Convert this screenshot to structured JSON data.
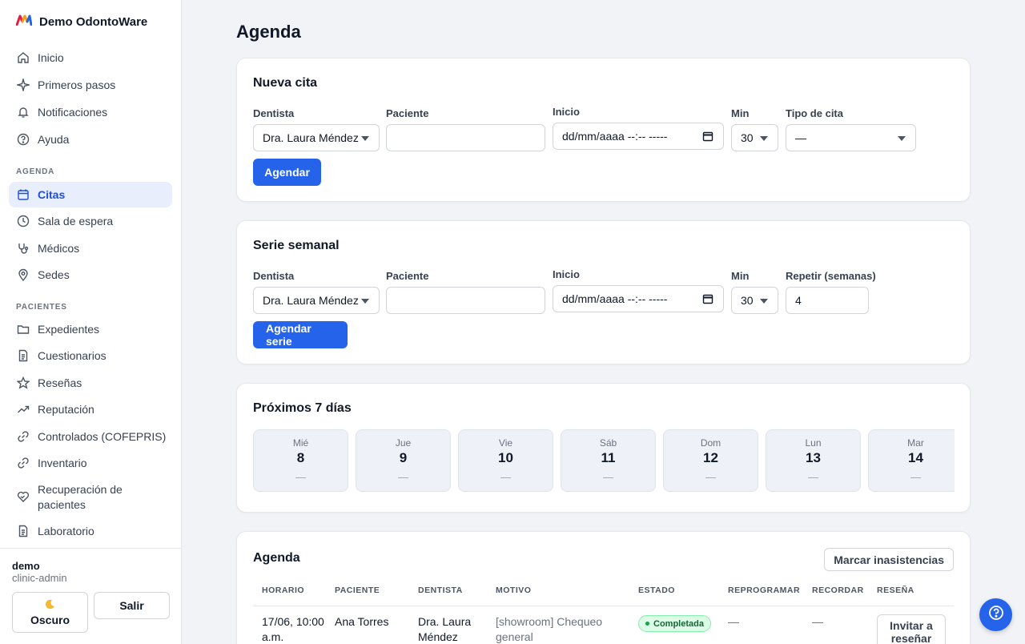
{
  "app": {
    "name": "Demo OdontoWare"
  },
  "sidebar": {
    "top_items": [
      {
        "label": "Inicio",
        "icon": "home-icon"
      },
      {
        "label": "Primeros pasos",
        "icon": "sparkle-icon"
      },
      {
        "label": "Notificaciones",
        "icon": "bell-icon"
      },
      {
        "label": "Ayuda",
        "icon": "help-circle-icon"
      }
    ],
    "sections": [
      {
        "title": "AGENDA",
        "items": [
          {
            "label": "Citas",
            "icon": "calendar-icon",
            "active": true
          },
          {
            "label": "Sala de espera",
            "icon": "clock-icon"
          },
          {
            "label": "Médicos",
            "icon": "stethoscope-icon"
          },
          {
            "label": "Sedes",
            "icon": "map-pin-icon"
          }
        ]
      },
      {
        "title": "PACIENTES",
        "items": [
          {
            "label": "Expedientes",
            "icon": "folder-icon"
          },
          {
            "label": "Cuestionarios",
            "icon": "document-icon"
          },
          {
            "label": "Reseñas",
            "icon": "star-icon"
          },
          {
            "label": "Reputación",
            "icon": "trending-up-icon"
          },
          {
            "label": "Controlados (COFEPRIS)",
            "icon": "link-icon"
          },
          {
            "label": "Inventario",
            "icon": "link-icon"
          },
          {
            "label": "Recuperación de pacientes",
            "icon": "heart-handshake-icon"
          },
          {
            "label": "Laboratorio",
            "icon": "document-icon"
          }
        ]
      }
    ],
    "user": {
      "name": "demo",
      "role": "clinic-admin"
    },
    "dark_mode_label": "Oscuro",
    "dark_mode_icon": "moon-icon",
    "logout_label": "Salir"
  },
  "page": {
    "title": "Agenda"
  },
  "new_appointment": {
    "title": "Nueva cita",
    "labels": {
      "dentist": "Dentista",
      "patient": "Paciente",
      "start": "Inicio",
      "min": "Min",
      "type": "Tipo de cita"
    },
    "values": {
      "dentist": "Dra. Laura Méndez",
      "patient": "",
      "start": "dd/mm/aaaa --:-- -----",
      "min": "30",
      "type": "—"
    },
    "submit_label": "Agendar"
  },
  "weekly_series": {
    "title": "Serie semanal",
    "labels": {
      "dentist": "Dentista",
      "patient": "Paciente",
      "start": "Inicio",
      "min": "Min",
      "repeat": "Repetir (semanas)"
    },
    "values": {
      "dentist": "Dra. Laura Méndez",
      "patient": "",
      "start": "dd/mm/aaaa --:-- -----",
      "min": "30",
      "repeat": "4"
    },
    "submit_label": "Agendar serie"
  },
  "next_days": {
    "title": "Próximos 7 días",
    "days": [
      {
        "name": "Mié",
        "num": "8",
        "count": "—"
      },
      {
        "name": "Jue",
        "num": "9",
        "count": "—"
      },
      {
        "name": "Vie",
        "num": "10",
        "count": "—"
      },
      {
        "name": "Sáb",
        "num": "11",
        "count": "—"
      },
      {
        "name": "Dom",
        "num": "12",
        "count": "—"
      },
      {
        "name": "Lun",
        "num": "13",
        "count": "—"
      },
      {
        "name": "Mar",
        "num": "14",
        "count": "—"
      }
    ]
  },
  "agenda": {
    "title": "Agenda",
    "mark_absences_label": "Marcar inasistencias",
    "columns": [
      "HORARIO",
      "PACIENTE",
      "DENTISTA",
      "MOTIVO",
      "ESTADO",
      "REPROGRAMAR",
      "RECORDAR",
      "RESEÑA"
    ],
    "rows": [
      {
        "time": "17/06, 10:00 a.m.",
        "patient": "Ana Torres",
        "dentist": "Dra. Laura Méndez",
        "reason": "[showroom] Chequeo general",
        "status": "Completada",
        "reschedule": "—",
        "remind": "—",
        "review_label": "Invitar a reseñar"
      }
    ]
  },
  "help_fab_icon": "help-circle-icon",
  "colors": {
    "primary": "#2563eb",
    "active_bg": "#e8eefb",
    "status_completed": "#16a34a"
  }
}
